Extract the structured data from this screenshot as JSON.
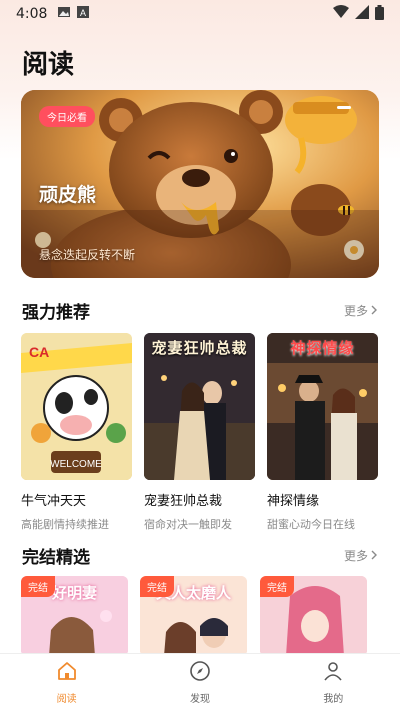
{
  "status_bar": {
    "time": "4:08"
  },
  "page": {
    "title": "阅读"
  },
  "banner": {
    "tag": "今日必看",
    "title": "顽皮熊",
    "subtitle": "悬念迭起反转不断"
  },
  "recommend": {
    "title": "强力推荐",
    "more": "更多",
    "items": [
      {
        "name": "牛气冲天天",
        "desc": "高能剧情持续推进",
        "cover_text": ""
      },
      {
        "name": "宠妻狂帅总裁",
        "desc": "宿命对决一触即发",
        "cover_text": "宠妻狂帅总裁"
      },
      {
        "name": "神探情缘",
        "desc": "甜蜜心动今日在线",
        "cover_text": "神探情缘"
      }
    ]
  },
  "finished": {
    "title": "完结精选",
    "more": "更多",
    "items": [
      {
        "badge": "完结",
        "cover_text": "好明妻"
      },
      {
        "badge": "完结",
        "cover_text": "夫人太磨人"
      },
      {
        "badge": "完结",
        "cover_text": ""
      }
    ]
  },
  "nav": {
    "items": [
      {
        "label": "阅读",
        "icon": "home-icon",
        "active": true
      },
      {
        "label": "发现",
        "icon": "compass-icon",
        "active": false
      },
      {
        "label": "我的",
        "icon": "person-icon",
        "active": false
      }
    ]
  },
  "colors": {
    "accent": "#f08a2d",
    "tag": "#ff4f5e",
    "badge": "#ff5a3c"
  }
}
